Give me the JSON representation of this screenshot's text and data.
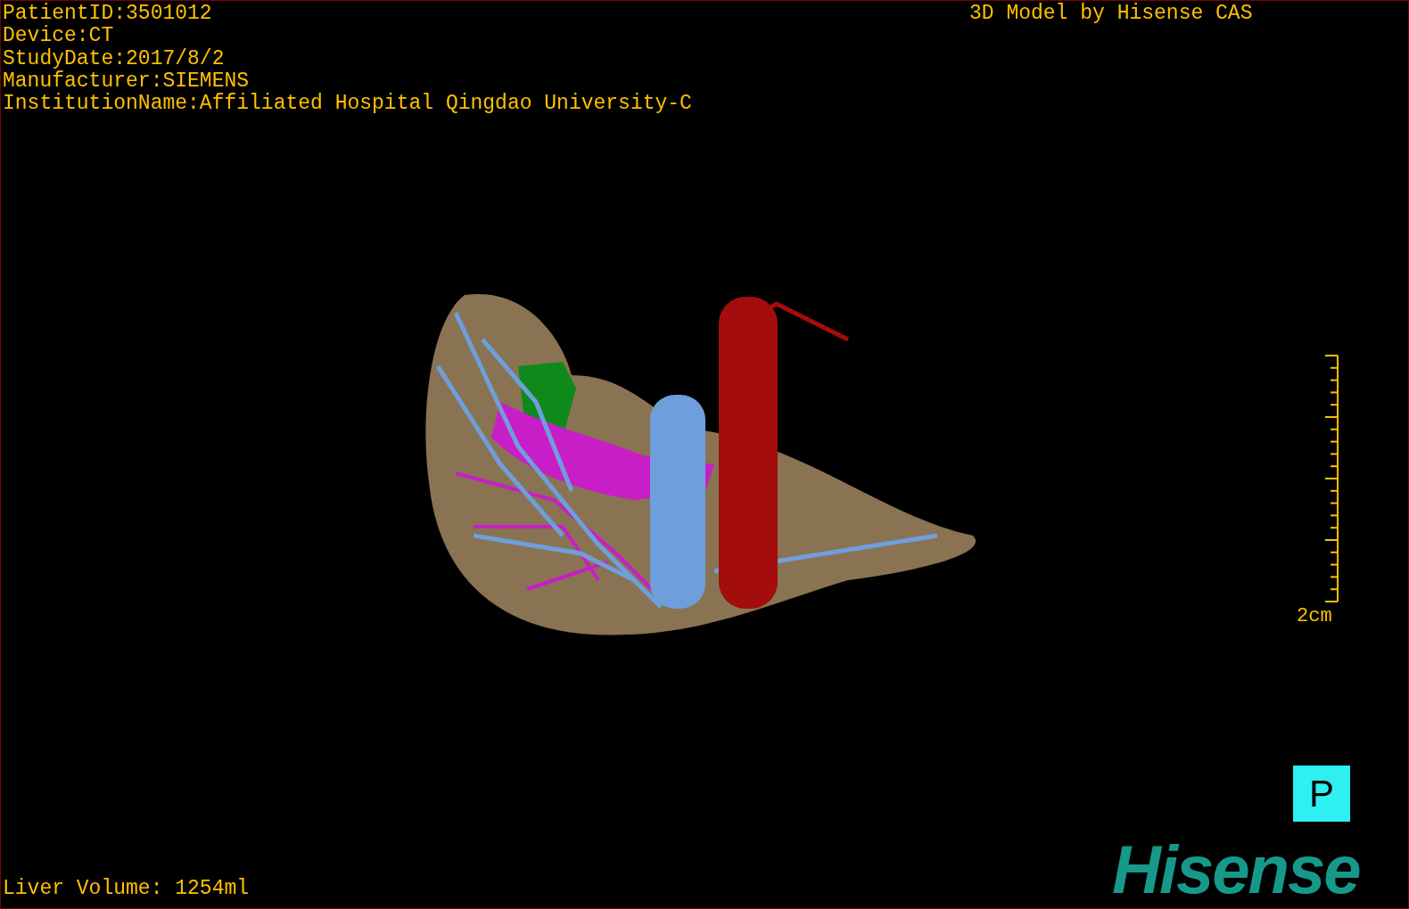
{
  "patient_info": [
    "PatientID:3501012",
    "Device:CT",
    "StudyDate:2017/8/2",
    "Manufacturer:SIEMENS",
    "InstitutionName:Affiliated Hospital Qingdao University-C"
  ],
  "model_credit": "3D Model by Hisense CAS",
  "scale_bar": {
    "label": "2cm"
  },
  "orientation_button": "P",
  "liver_volume": "Liver Volume: 1254ml",
  "logo": "Hisense"
}
